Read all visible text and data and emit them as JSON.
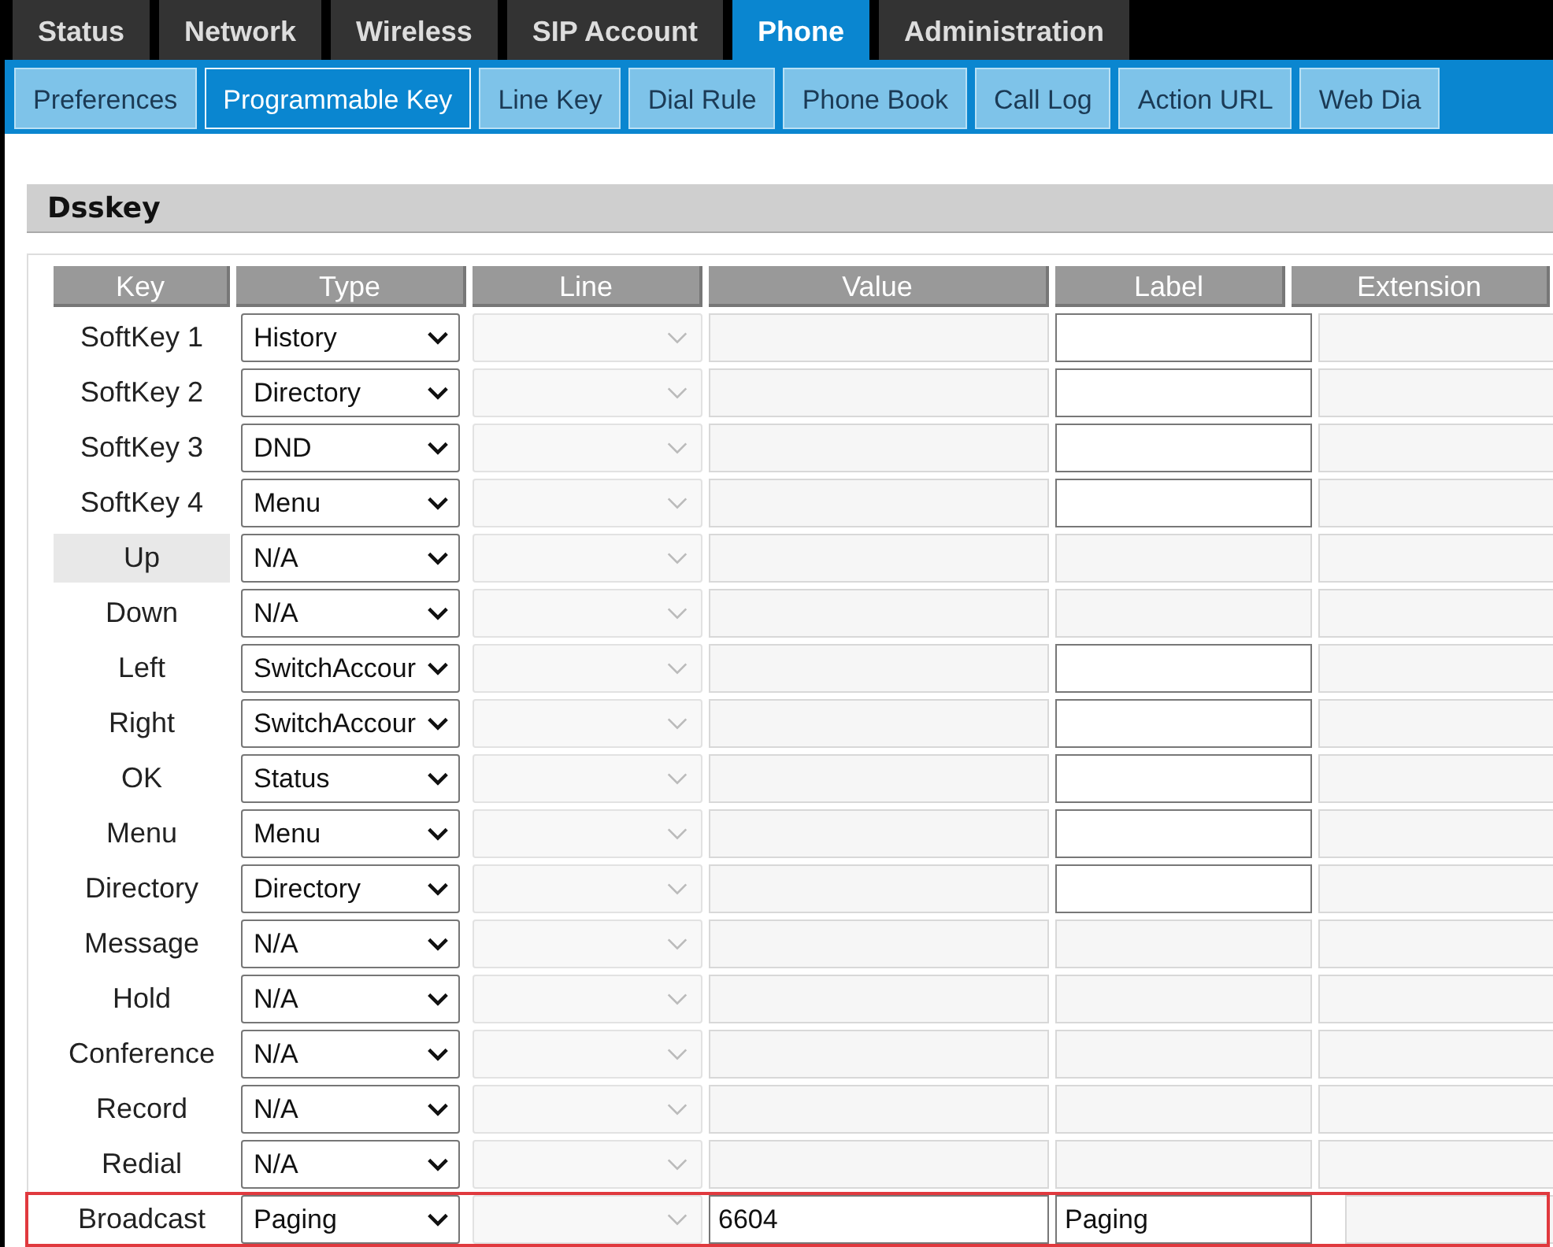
{
  "main_tabs": [
    {
      "label": "Status",
      "selected": false
    },
    {
      "label": "Network",
      "selected": false
    },
    {
      "label": "Wireless",
      "selected": false
    },
    {
      "label": "SIP Account",
      "selected": false
    },
    {
      "label": "Phone",
      "selected": true
    },
    {
      "label": "Administration",
      "selected": false
    }
  ],
  "sub_tabs": [
    {
      "label": "Preferences",
      "selected": false
    },
    {
      "label": "Programmable Key",
      "selected": true
    },
    {
      "label": "Line Key",
      "selected": false
    },
    {
      "label": "Dial Rule",
      "selected": false
    },
    {
      "label": "Phone Book",
      "selected": false
    },
    {
      "label": "Call Log",
      "selected": false
    },
    {
      "label": "Action URL",
      "selected": false
    },
    {
      "label": "Web Dia",
      "selected": false
    }
  ],
  "section": {
    "title": "Dsskey"
  },
  "table": {
    "columns": [
      "Key",
      "Type",
      "Line",
      "Value",
      "Label",
      "Extension"
    ],
    "rows": [
      {
        "key": "SoftKey 1",
        "type": "History",
        "value_enabled": false,
        "label_enabled": true,
        "hovered": false,
        "outlined": false
      },
      {
        "key": "SoftKey 2",
        "type": "Directory",
        "value_enabled": false,
        "label_enabled": true,
        "hovered": false,
        "outlined": false
      },
      {
        "key": "SoftKey 3",
        "type": "DND",
        "value_enabled": false,
        "label_enabled": true,
        "hovered": false,
        "outlined": false
      },
      {
        "key": "SoftKey 4",
        "type": "Menu",
        "value_enabled": false,
        "label_enabled": true,
        "hovered": false,
        "outlined": false
      },
      {
        "key": "Up",
        "type": "N/A",
        "value_enabled": false,
        "label_enabled": false,
        "hovered": true,
        "outlined": false
      },
      {
        "key": "Down",
        "type": "N/A",
        "value_enabled": false,
        "label_enabled": false,
        "hovered": false,
        "outlined": false
      },
      {
        "key": "Left",
        "type": "SwitchAccour",
        "value_enabled": false,
        "label_enabled": true,
        "hovered": false,
        "outlined": false
      },
      {
        "key": "Right",
        "type": "SwitchAccour",
        "value_enabled": false,
        "label_enabled": true,
        "hovered": false,
        "outlined": false
      },
      {
        "key": "OK",
        "type": "Status",
        "value_enabled": false,
        "label_enabled": true,
        "hovered": false,
        "outlined": false
      },
      {
        "key": "Menu",
        "type": "Menu",
        "value_enabled": false,
        "label_enabled": true,
        "hovered": false,
        "outlined": false
      },
      {
        "key": "Directory",
        "type": "Directory",
        "value_enabled": false,
        "label_enabled": true,
        "hovered": false,
        "outlined": false
      },
      {
        "key": "Message",
        "type": "N/A",
        "value_enabled": false,
        "label_enabled": false,
        "hovered": false,
        "outlined": false
      },
      {
        "key": "Hold",
        "type": "N/A",
        "value_enabled": false,
        "label_enabled": false,
        "hovered": false,
        "outlined": false
      },
      {
        "key": "Conference",
        "type": "N/A",
        "value_enabled": false,
        "label_enabled": false,
        "hovered": false,
        "outlined": false
      },
      {
        "key": "Record",
        "type": "N/A",
        "value_enabled": false,
        "label_enabled": false,
        "hovered": false,
        "outlined": false
      },
      {
        "key": "Redial",
        "type": "N/A",
        "value_enabled": false,
        "label_enabled": false,
        "hovered": false,
        "outlined": false
      },
      {
        "key": "Broadcast",
        "type": "Paging",
        "value": "6604",
        "label": "Paging",
        "value_enabled": true,
        "label_enabled": true,
        "hovered": false,
        "outlined": true
      }
    ]
  }
}
